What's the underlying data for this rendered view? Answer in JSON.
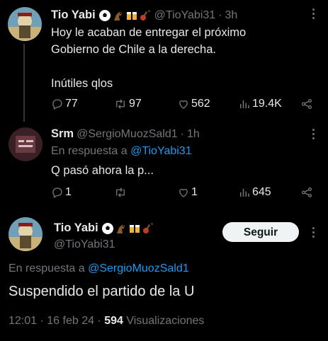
{
  "tweet1": {
    "display_name": "Tio Yabi",
    "handle": "@TioYabi31",
    "separator": "·",
    "time": "3h",
    "text": "Hoy le acaban de entregar el próximo\nGobierno de Chile a la derecha.\n\nInútiles qlos",
    "replies": "77",
    "retweets": "97",
    "likes": "562",
    "views": "19.4K"
  },
  "tweet2": {
    "display_name": "Srm",
    "handle": "@SergioMuozSald1",
    "separator": "·",
    "time": "1h",
    "reply_prefix": "En respuesta a",
    "reply_handle": "@TioYabi31",
    "text": "Q pasó ahora la p...",
    "replies": "1",
    "retweets": "",
    "likes": "1",
    "views": "645"
  },
  "tweet3": {
    "display_name": "Tio Yabi",
    "handle": "@TioYabi31",
    "follow_label": "Seguir",
    "reply_prefix": "En respuesta a",
    "reply_handle": "@SergioMuozSald1",
    "text": "Suspendido el partido de la U",
    "time": "12:01",
    "date": "16 feb 24",
    "separator": "·",
    "views_count": "594",
    "views_label": "Visualizaciones"
  },
  "colors": {
    "background": "#000000",
    "primary_text": "#e7e9ea",
    "secondary_text": "#71767b",
    "link": "#1d9bf0",
    "divider": "#2f3336",
    "button_bg": "#eff3f4"
  },
  "icons": {
    "name_emojis": [
      "soccer-ball-icon",
      "horse-icon",
      "beer-mugs-icon",
      "guitar-icon"
    ],
    "actions": [
      "reply-icon",
      "retweet-icon",
      "like-icon",
      "views-icon",
      "share-icon"
    ],
    "more": "more-options-icon"
  }
}
